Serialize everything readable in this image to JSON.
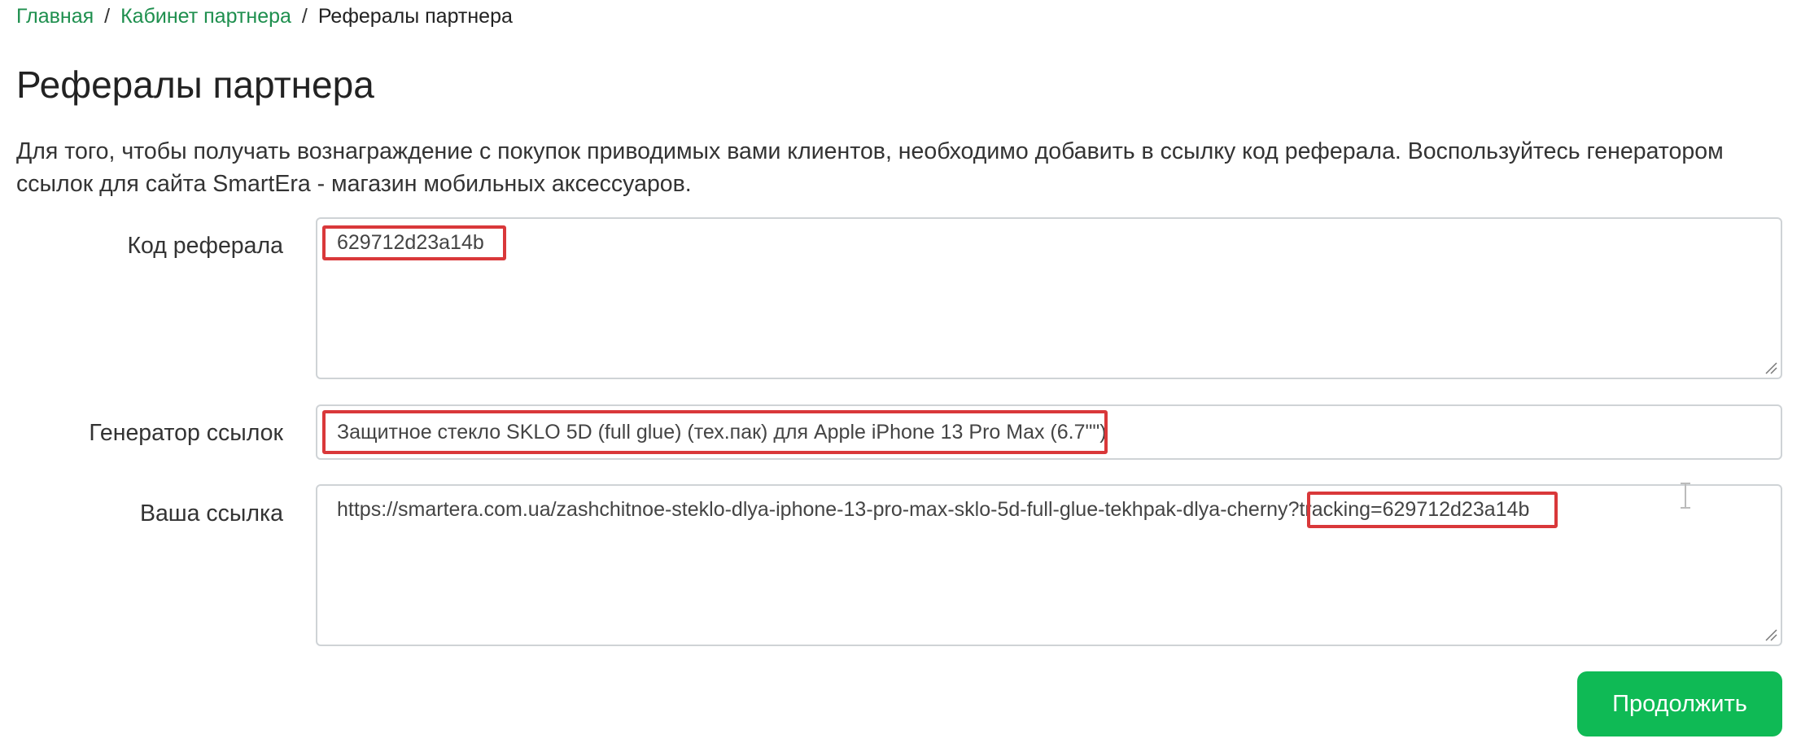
{
  "breadcrumb": {
    "home": "Главная",
    "cabinet": "Кабинет партнера",
    "current": "Рефералы партнера",
    "separator": "/"
  },
  "page": {
    "title": "Рефералы партнера",
    "intro": "Для того, чтобы получать вознаграждение с покупок приводимых вами клиентов, необходимо добавить в ссылку код реферала. Воспользуйтесь генератором ссылок для сайта SmartEra - магазин мобильных аксессуаров."
  },
  "form": {
    "referral_code": {
      "label": "Код реферала",
      "value": "629712d23a14b"
    },
    "link_generator": {
      "label": "Генератор ссылок",
      "value": "Защитное стекло SKLO 5D (full glue) (тех.пак) для Apple iPhone 13 Pro Max (6.7\"\")"
    },
    "your_link": {
      "label": "Ваша ссылка",
      "value_base": "https://smartera.com.ua/zashchitnoe-steklo-dlya-iphone-13-pro-max-sklo-5d-full-glue-tekhpak-dlya-cherny",
      "value_tracking": "?tracking=629712d23a14b"
    },
    "continue_label": "Продолжить"
  },
  "colors": {
    "link": "#1e8f4e",
    "button": "#0fba55",
    "highlight": "#d9383a",
    "border": "#cfd3d6"
  }
}
